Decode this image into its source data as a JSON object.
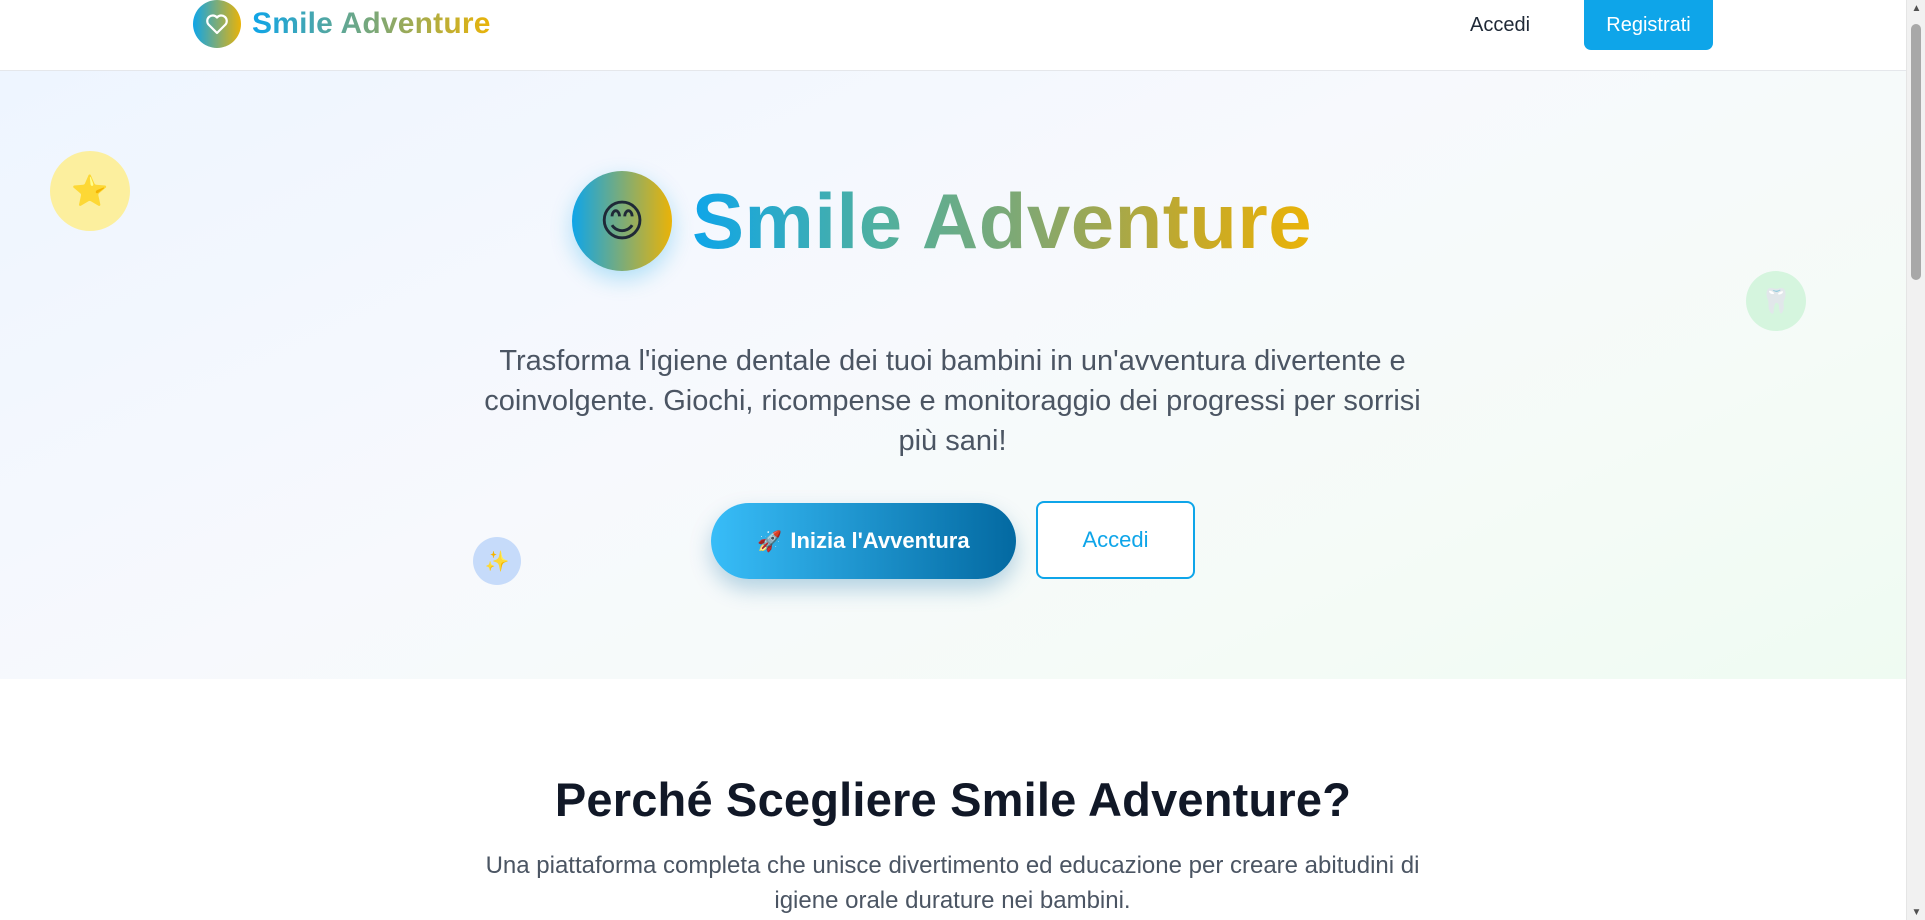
{
  "nav": {
    "brand": "Smile Adventure",
    "login_label": "Accedi",
    "signup_label": "Registrati",
    "logo_icon": "heart-icon"
  },
  "hero": {
    "title": "Smile Adventure",
    "title_icon": "😊",
    "subtitle": "Trasforma l'igiene dentale dei tuoi bambini in un'avventura divertente e coinvolgente. Giochi, ricompense e monitoraggio dei progressi per sorrisi più sani!",
    "start_button_icon": "🚀",
    "start_button_label": "Inizia l'Avventura",
    "login_button_label": "Accedi",
    "decorations": {
      "star": "⭐",
      "tooth": "🦷",
      "sparkle": "✨"
    }
  },
  "why": {
    "title": "Perché Scegliere Smile Adventure?",
    "subtitle": "Una piattaforma completa che unisce divertimento ed educazione per creare abitudini di igiene orale durature nei bambini."
  },
  "colors": {
    "primary": "#0ea5e9",
    "accent_yellow": "#eab308",
    "button_gradient_end": "#0369a1"
  }
}
